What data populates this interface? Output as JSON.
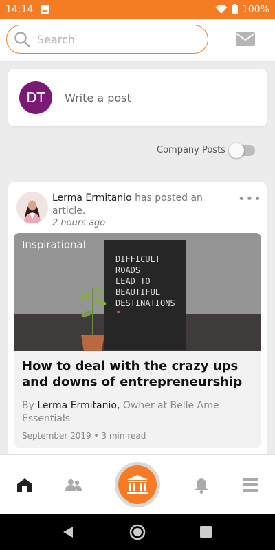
{
  "status_bar": {
    "time": "14:14",
    "battery": "100%"
  },
  "search": {
    "placeholder": "Search"
  },
  "composer": {
    "avatar_initials": "DT",
    "prompt": "Write a post"
  },
  "filter": {
    "company_posts_label": "Company Posts",
    "company_posts_on": false
  },
  "feed": {
    "author_name": "Lerma Ermitanio",
    "action_text": "has posted an article.",
    "time": "2 hours ago",
    "more_label": "•••",
    "article": {
      "category": "Inspirational",
      "image_text": "DIFFICULT ROADS LEAD TO BEAUTIFUL DESTINATIONS",
      "title": "How to deal with the crazy ups and downs of entrepreneurship",
      "by_prefix": "By",
      "by_name": "Lerma Ermitanio,",
      "by_role": "Owner at Belle Ame Essentials",
      "date": "September 2019",
      "separator": "•",
      "read_time": "3 min read"
    }
  },
  "colors": {
    "accent": "#f57c24",
    "avatar": "#7b1a75"
  },
  "nav": {
    "items": [
      "home-icon",
      "people-icon",
      "institution-icon",
      "bell-icon",
      "menu-icon"
    ]
  }
}
